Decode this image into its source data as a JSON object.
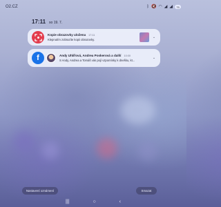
{
  "status_bar": {
    "carrier": "O2.CZ",
    "icons": [
      "bluetooth-icon",
      "silent-icon",
      "wifi-icon",
      "signal-icon"
    ],
    "battery_percent": "75",
    "battery_icon": "battery-icon"
  },
  "lockscreen": {
    "time": "17:11",
    "date": "so 19. 7."
  },
  "notifications": [
    {
      "app_icon": "screenshot-icon",
      "title": "Kopie obrazovky uložena",
      "time": "17:11",
      "body": "Klepnutím zobrazíte kopii obrazovky.",
      "expand_icon": "chevron-down-icon"
    },
    {
      "app_icon": "facebook-icon",
      "title": "Andy Uhlířová, Andrea Poskerová a další",
      "time": "10:00",
      "body": "S Andy, Andrea a Tomáš vás pojí vzpomínky k dnešku, kt...",
      "expand_icon": "chevron-down-icon"
    }
  ],
  "actions": {
    "settings_label": "Nastavení oznámení",
    "clear_label": "Smazat"
  },
  "nav": {
    "recents_icon": "recents-icon",
    "home_icon": "home-icon",
    "back_icon": "back-icon"
  },
  "colors": {
    "screenshot_app": "#e33c4d",
    "facebook": "#1a73e8",
    "card_bg": "#eef1fc"
  }
}
